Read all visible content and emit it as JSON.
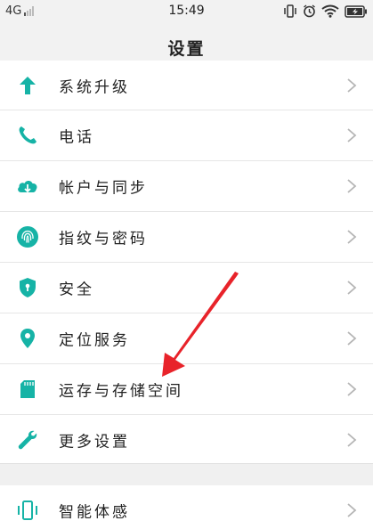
{
  "status_bar": {
    "network": "4G",
    "time": "15:49"
  },
  "header": {
    "title": "设置"
  },
  "settings": {
    "items": [
      {
        "label": "系统升级",
        "icon": "arrow-up-icon"
      },
      {
        "label": "电话",
        "icon": "phone-icon"
      },
      {
        "label": "帐户与同步",
        "icon": "cloud-sync-icon"
      },
      {
        "label": "指纹与密码",
        "icon": "fingerprint-icon"
      },
      {
        "label": "安全",
        "icon": "shield-icon"
      },
      {
        "label": "定位服务",
        "icon": "location-pin-icon"
      },
      {
        "label": "运存与存储空间",
        "icon": "sd-card-icon"
      },
      {
        "label": "更多设置",
        "icon": "wrench-icon"
      }
    ],
    "second_group": [
      {
        "label": "智能体感",
        "icon": "motion-sense-icon"
      }
    ]
  },
  "colors": {
    "accent": "#16b3a6",
    "annotation_arrow": "#e8232a",
    "chevron": "#b5b5b5"
  }
}
